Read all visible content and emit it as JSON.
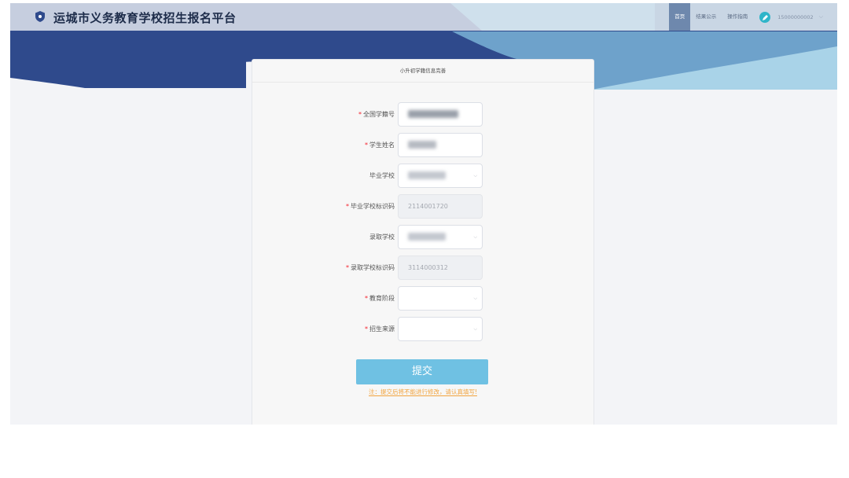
{
  "header": {
    "site_title": "运城市义务教育学校招生报名平台",
    "nav": [
      "首页",
      "结果公示",
      "操作指南"
    ],
    "user_phone": "15000000002",
    "colors": {
      "brand_dark": "#2f4a8c",
      "accent": "#6fc1e3",
      "required": "#f5222d"
    }
  },
  "form": {
    "title": "小升初学籍信息完善",
    "fields": [
      {
        "label": "全国学籍号",
        "required": true,
        "type": "input",
        "value": "",
        "disabled": false
      },
      {
        "label": "学生姓名",
        "required": true,
        "type": "input",
        "value": "",
        "disabled": false
      },
      {
        "label": "毕业学校",
        "required": false,
        "type": "select",
        "value": "",
        "disabled": false
      },
      {
        "label": "毕业学校标识码",
        "required": true,
        "type": "input",
        "value": "2114001720",
        "disabled": true
      },
      {
        "label": "录取学校",
        "required": false,
        "type": "select",
        "value": "",
        "disabled": false
      },
      {
        "label": "录取学校标识码",
        "required": true,
        "type": "input",
        "value": "3114000312",
        "disabled": true
      },
      {
        "label": "教育阶段",
        "required": true,
        "type": "select",
        "value": "",
        "disabled": false
      },
      {
        "label": "招生来源",
        "required": true,
        "type": "select",
        "value": "",
        "disabled": false
      }
    ],
    "submit_label": "提交",
    "notice": "注：提交后将不能进行修改，请认真填写!"
  }
}
